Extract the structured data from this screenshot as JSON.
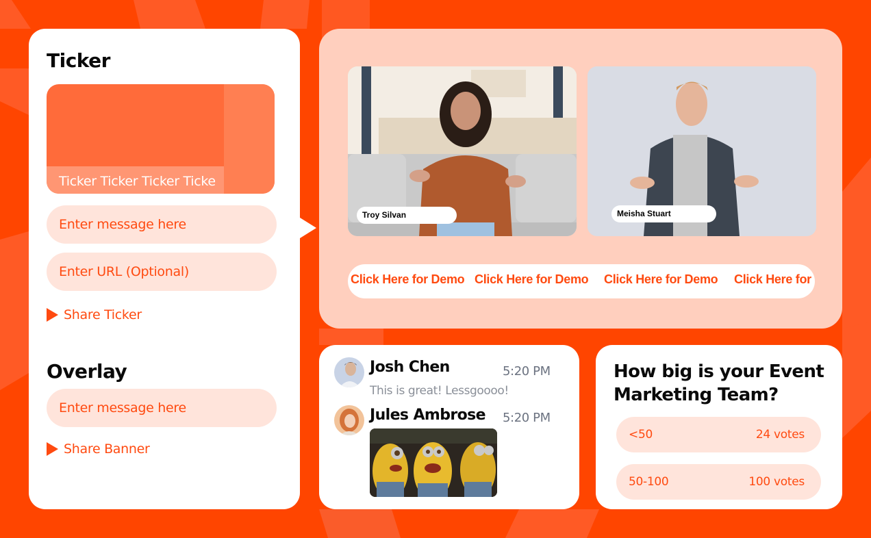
{
  "theme": {
    "brand": "#FF4500",
    "accent_text": "#FF4A10",
    "input_bg": "#FFE4DB",
    "stage_bg": "#FFCFBE"
  },
  "ticker": {
    "title": "Ticker",
    "preview_text": "Ticker Ticker Ticker Ticke",
    "message_placeholder": "Enter message here",
    "url_placeholder": "Enter URL (Optional)",
    "share_label": "Share Ticker",
    "share_icon": "play-icon"
  },
  "overlay": {
    "title": "Overlay",
    "message_placeholder": "Enter message here",
    "share_label": "Share Banner",
    "share_icon": "play-icon"
  },
  "stage": {
    "participants": [
      {
        "name": "Troy Silvan"
      },
      {
        "name": "Meisha Stuart"
      }
    ],
    "banner_links": [
      "Click Here for Demo",
      "Click Here for Demo",
      "Click Here for Demo",
      "Click Here for"
    ]
  },
  "chat": {
    "messages": [
      {
        "author": "Josh Chen",
        "time": "5:20 PM",
        "text": "This is great! Lessgoooo!"
      },
      {
        "author": "Jules Ambrose",
        "time": "5:20 PM",
        "attachment": "gif-minions"
      }
    ]
  },
  "poll": {
    "question": "How big is your Event Marketing Team?",
    "options": [
      {
        "label": "<50",
        "votes": "24 votes"
      },
      {
        "label": "50-100",
        "votes": "100 votes"
      }
    ]
  }
}
